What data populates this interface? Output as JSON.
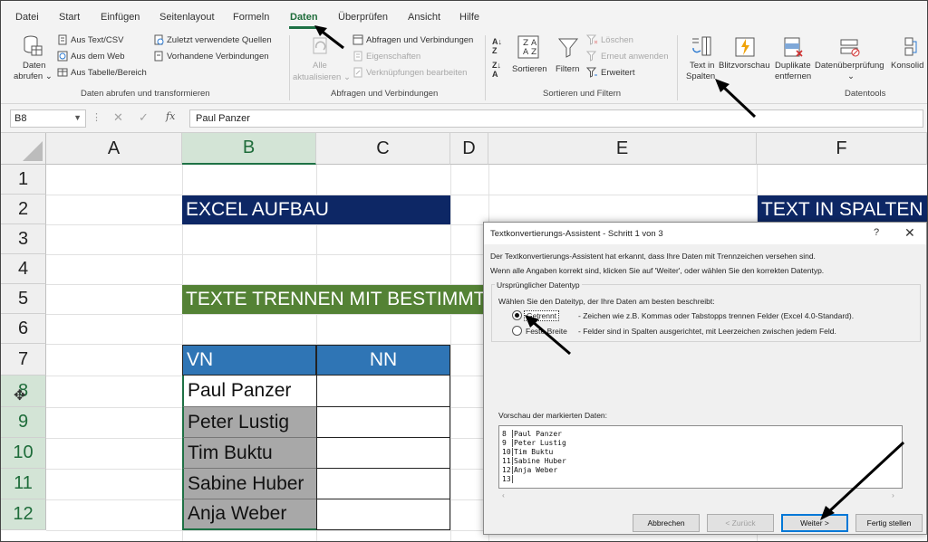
{
  "menu": {
    "tabs": [
      "Datei",
      "Start",
      "Einfügen",
      "Seitenlayout",
      "Formeln",
      "Daten",
      "Überprüfen",
      "Ansicht",
      "Hilfe"
    ],
    "active": "Daten"
  },
  "ribbon": {
    "get_data": {
      "daten_line1": "Daten",
      "daten_line2": "abrufen",
      "aus_text_csv": "Aus Text/CSV",
      "aus_dem_web": "Aus dem Web",
      "aus_tabelle": "Aus Tabelle/Bereich",
      "zuletzt": "Zuletzt verwendete Quellen",
      "vorhandene": "Vorhandene Verbindungen",
      "group_label": "Daten abrufen und transformieren"
    },
    "queries": {
      "alle_line1": "Alle",
      "alle_line2": "aktualisieren",
      "abfragen": "Abfragen und Verbindungen",
      "eigenschaften": "Eigenschaften",
      "verknuepfungen": "Verknüpfungen bearbeiten",
      "group_label": "Abfragen und Verbindungen"
    },
    "sort": {
      "sortieren": "Sortieren",
      "filtern": "Filtern",
      "loeschen": "Löschen",
      "erneut": "Erneut anwenden",
      "erweitert": "Erweitert",
      "group_label": "Sortieren und Filtern"
    },
    "tools": {
      "text_line1": "Text in",
      "text_line2": "Spalten",
      "blitz": "Blitzvorschau",
      "dup_line1": "Duplikate",
      "dup_line2": "entfernen",
      "datenueberpruefung": "Datenüberprüfung",
      "konsolid": "Konsolid",
      "group_label": "Datentools"
    }
  },
  "formula_bar": {
    "name_box": "B8",
    "fx": "fx",
    "value": "Paul Panzer"
  },
  "grid": {
    "columns": [
      "A",
      "B",
      "C",
      "D",
      "E",
      "F"
    ],
    "rows": [
      "1",
      "2",
      "3",
      "4",
      "5",
      "6",
      "7",
      "8",
      "9",
      "10",
      "11",
      "12"
    ],
    "b2": "EXCEL AUFBAU",
    "f2": "TEXT IN SPALTEN",
    "b5": "TEXTE TRENNEN MIT BESTIMMTEN",
    "b7": "VN",
    "c7": "NN",
    "names": [
      "Paul Panzer",
      "Peter Lustig",
      "Tim Buktu",
      "Sabine Huber",
      "Anja Weber"
    ]
  },
  "dialog": {
    "title": "Textkonvertierungs-Assistent - Schritt 1 von 3",
    "help": "?",
    "close": "✕",
    "intro1": "Der Textkonvertierungs-Assistent hat erkannt, dass Ihre Daten mit Trennzeichen versehen sind.",
    "intro2": "Wenn alle Angaben korrekt sind, klicken Sie auf 'Weiter', oder wählen Sie den korrekten Datentyp.",
    "fieldset_label": "Ursprünglicher Datentyp",
    "fieldset_prompt": "Wählen Sie den Dateityp, der Ihre Daten am besten beschreibt:",
    "opt1_label": "Getrennt",
    "opt1_desc": "- Zeichen wie z.B. Kommas oder Tabstopps trennen Felder (Excel 4.0-Standard).",
    "opt2_label": "Feste Breite",
    "opt2_desc": "- Felder sind in Spalten ausgerichtet, mit Leerzeichen zwischen jedem Feld.",
    "preview_label": "Vorschau der markierten Daten:",
    "preview_rows": [
      {
        "n": "8",
        "t": "Paul Panzer"
      },
      {
        "n": "9",
        "t": "Peter Lustig"
      },
      {
        "n": "10",
        "t": "Tim Buktu"
      },
      {
        "n": "11",
        "t": "Sabine Huber"
      },
      {
        "n": "12",
        "t": "Anja Weber"
      },
      {
        "n": "13",
        "t": ""
      }
    ],
    "btn_cancel": "Abbrechen",
    "btn_back": "< Zurück",
    "btn_next": "Weiter >",
    "btn_finish": "Fertig stellen"
  },
  "colors": {
    "excel_green": "#1e7145",
    "navy_band": "#0d2765",
    "green_band": "#548235",
    "header_blue": "#2f75b5"
  }
}
